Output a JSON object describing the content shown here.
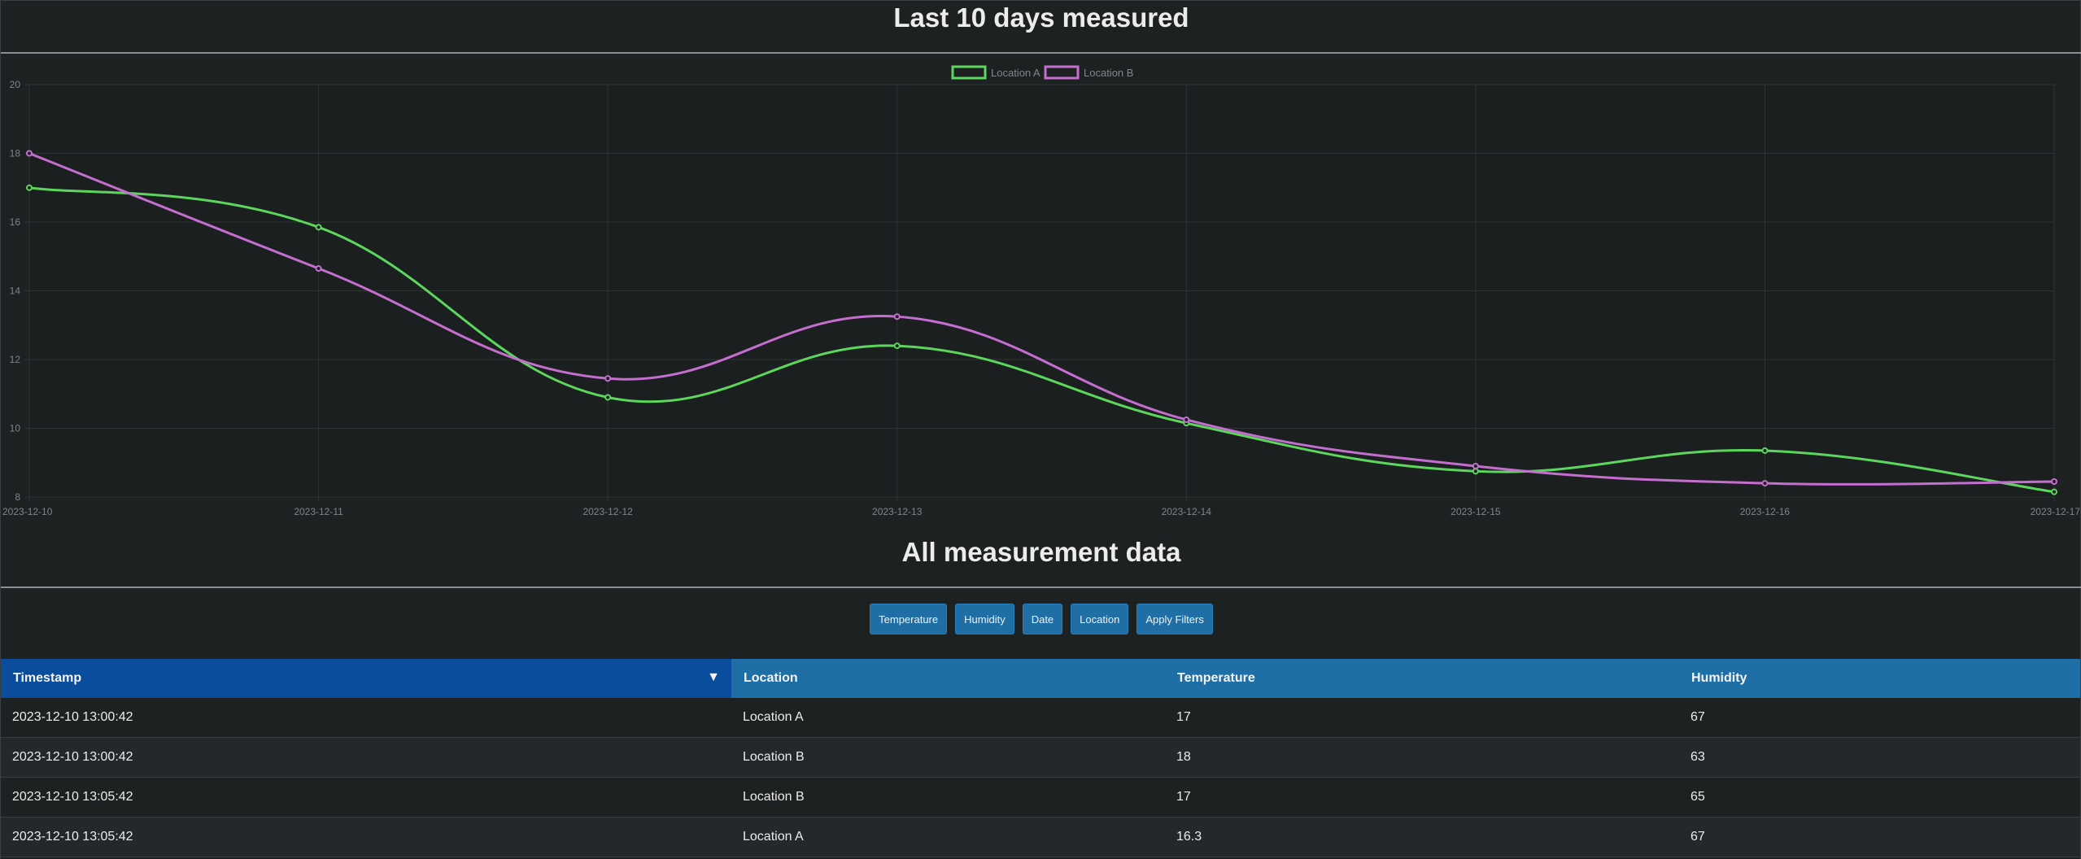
{
  "chart_section": {
    "title": "Last 10 days measured"
  },
  "chart_data": {
    "type": "line",
    "x": [
      "2023-12-10",
      "2023-12-11",
      "2023-12-12",
      "2023-12-13",
      "2023-12-14",
      "2023-12-15",
      "2023-12-16",
      "2023-12-17"
    ],
    "series": [
      {
        "name": "Location A",
        "color": "#5cd65c",
        "values": [
          17,
          15.85,
          10.9,
          12.4,
          10.15,
          8.75,
          9.35,
          8.15
        ]
      },
      {
        "name": "Location B",
        "color": "#c46ed0",
        "values": [
          18,
          14.65,
          11.45,
          13.25,
          10.25,
          8.9,
          8.4,
          8.45
        ]
      }
    ],
    "ylim": [
      8,
      20
    ],
    "yticks": [
      8,
      10,
      12,
      14,
      16,
      18,
      20
    ],
    "grid": true,
    "legend": "top-center"
  },
  "table_section": {
    "title": "All measurement data"
  },
  "filters": [
    {
      "label": "Temperature"
    },
    {
      "label": "Humidity"
    },
    {
      "label": "Date"
    },
    {
      "label": "Location"
    },
    {
      "label": "Apply Filters"
    }
  ],
  "table": {
    "sort_indicator": "▼",
    "columns": [
      "Timestamp",
      "Location",
      "Temperature",
      "Humidity"
    ],
    "rows": [
      [
        "2023-12-10 13:00:42",
        "Location A",
        "17",
        "67"
      ],
      [
        "2023-12-10 13:00:42",
        "Location B",
        "18",
        "63"
      ],
      [
        "2023-12-10 13:05:42",
        "Location B",
        "17",
        "65"
      ],
      [
        "2023-12-10 13:05:42",
        "Location A",
        "16.3",
        "67"
      ]
    ]
  }
}
